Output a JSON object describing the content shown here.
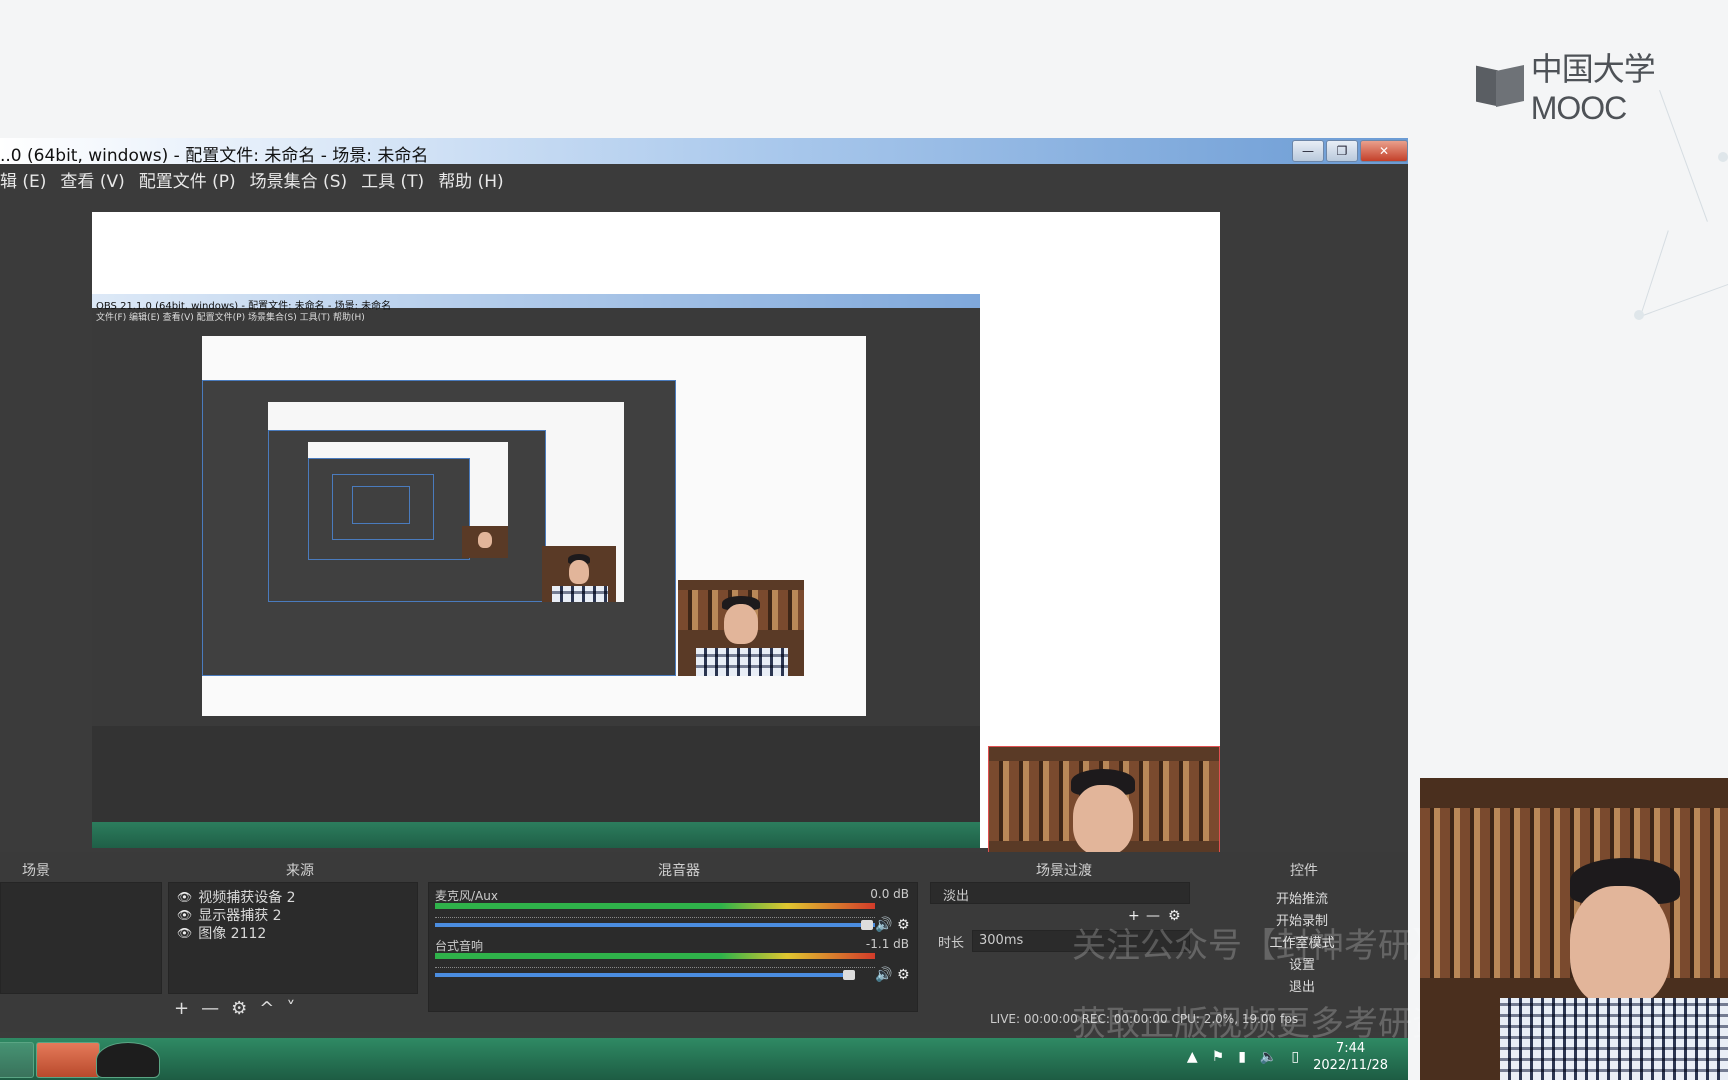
{
  "mooc": {
    "brand": "中国大学MOOC"
  },
  "window": {
    "title": "..0 (64bit, windows) - 配置文件: 未命名 - 场景: 未命名",
    "controls": [
      "—",
      "❐",
      "✕"
    ]
  },
  "menu": [
    "辑 (E)",
    "查看 (V)",
    "配置文件 (P)",
    "场景集合 (S)",
    "工具 (T)",
    "帮助 (H)"
  ],
  "nested": {
    "title": "OBS 21.1.0 (64bit, windows) - 配置文件: 未命名 - 场景: 未命名",
    "menu": "文件(F)   编辑(E)   查看(V)   配置文件(P)   场景集合(S)   工具(T)   帮助(H)"
  },
  "docks": {
    "scenes": {
      "header": "场景"
    },
    "sources": {
      "header": "来源",
      "items": [
        "视频捕获设备 2",
        "显示器捕获 2",
        "图像 2112"
      ],
      "tools": [
        "+",
        "—",
        "⚙",
        "^",
        "˅"
      ]
    },
    "mixer": {
      "header": "混音器",
      "channels": [
        {
          "name": "麦克风/Aux",
          "db": "0.0 dB"
        },
        {
          "name": "台式音响",
          "db": "-1.1 dB"
        }
      ]
    },
    "transitions": {
      "header": "场景过渡",
      "type": "淡出",
      "duration_label": "时长",
      "duration": "300ms"
    },
    "controls": {
      "header": "控件",
      "buttons": [
        "开始推流",
        "开始录制",
        "工作室模式",
        "设置",
        "退出"
      ]
    }
  },
  "status": "LIVE: 00:00:00   REC: 00:00:00   CPU: 2.0%, 19.00 fps",
  "watermarks": [
    "关注公众号【封神考研】",
    "获取正版视频更多考研资料"
  ],
  "taskbar": {
    "time": "7:44",
    "date": "2022/11/28",
    "tray": [
      "▲",
      "⚑",
      "▮",
      "🔈",
      "▯"
    ]
  }
}
